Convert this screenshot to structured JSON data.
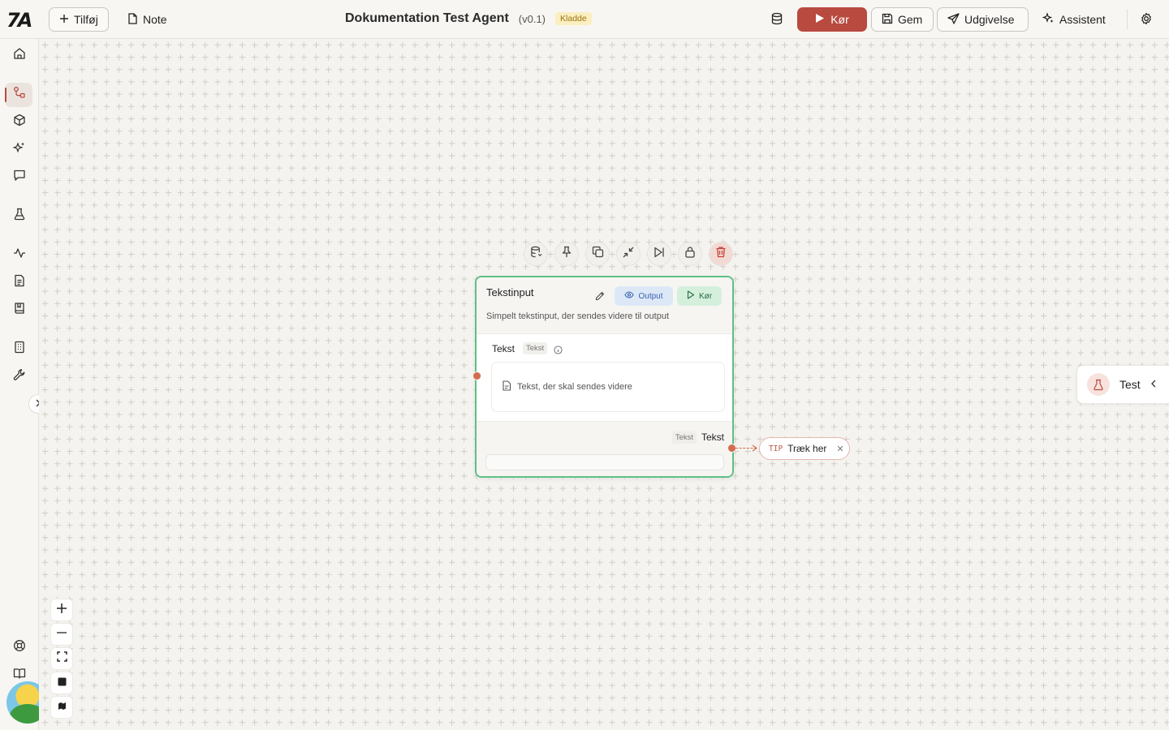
{
  "topbar": {
    "add_label": "Tilføj",
    "note_label": "Note",
    "title": "Dokumentation Test Agent",
    "version": "(v0.1)",
    "status_badge": "Kladde",
    "run_label": "Kør",
    "save_label": "Gem",
    "publish_label": "Udgivelse",
    "assistant_label": "Assistent",
    "accent_color": "#b84a40"
  },
  "sidebar": {
    "items": [
      {
        "icon": "home-icon"
      },
      {
        "icon": "workflow-icon",
        "active": true
      },
      {
        "icon": "cube-icon"
      },
      {
        "icon": "sparkles-icon"
      },
      {
        "icon": "chat-icon"
      },
      {
        "icon": "flask-icon"
      },
      {
        "icon": "activity-icon"
      },
      {
        "icon": "document-icon"
      },
      {
        "icon": "book-icon"
      },
      {
        "icon": "building-icon"
      },
      {
        "icon": "wrench-icon"
      },
      {
        "icon": "help-circle-icon"
      },
      {
        "icon": "open-book-icon"
      }
    ]
  },
  "node": {
    "title": "Tekstinput",
    "description": "Simpelt tekstinput, der sendes videre til output",
    "output_chip": "Output",
    "run_chip": "Kør",
    "input_label": "Tekst",
    "input_type": "Tekst",
    "input_placeholder": "Tekst, der skal sendes videre",
    "output_type": "Tekst",
    "output_label": "Tekst",
    "border_color": "#5fbf85"
  },
  "node_toolbar": [
    "database-icon",
    "pin-icon",
    "copy-icon",
    "minimize-icon",
    "skip-forward-icon",
    "lock-icon",
    "trash-icon"
  ],
  "tip": {
    "tag": "TIP",
    "text": "Træk her"
  },
  "test_panel": {
    "label": "Test"
  }
}
